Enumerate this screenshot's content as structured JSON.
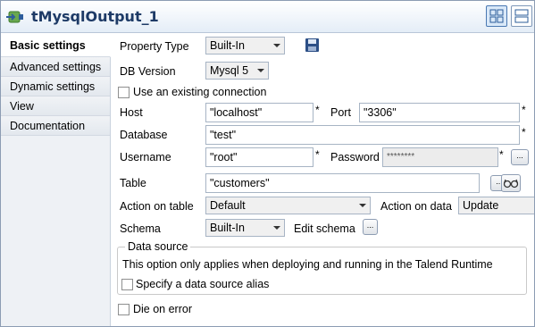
{
  "window": {
    "title": "tMysqlOutput_1"
  },
  "sidebar": {
    "items": [
      {
        "label": "Basic settings"
      },
      {
        "label": "Advanced settings"
      },
      {
        "label": "Dynamic settings"
      },
      {
        "label": "View"
      },
      {
        "label": "Documentation"
      }
    ]
  },
  "form": {
    "property_type": {
      "label": "Property Type",
      "value": "Built-In"
    },
    "db_version": {
      "label": "DB Version",
      "value": "Mysql 5"
    },
    "use_existing": {
      "label": "Use an existing connection",
      "checked": false
    },
    "host": {
      "label": "Host",
      "value": "\"localhost\""
    },
    "port": {
      "label": "Port",
      "value": "\"3306\""
    },
    "database": {
      "label": "Database",
      "value": "\"test\""
    },
    "username": {
      "label": "Username",
      "value": "\"root\""
    },
    "password": {
      "label": "Password",
      "value": "********"
    },
    "table": {
      "label": "Table",
      "value": "\"customers\""
    },
    "action_on_table": {
      "label": "Action on table",
      "value": "Default"
    },
    "action_on_data": {
      "label": "Action on data",
      "value": "Update"
    },
    "schema": {
      "label": "Schema",
      "value": "Built-In"
    },
    "edit_schema": {
      "label": "Edit schema"
    },
    "required_marker": "*",
    "ellipsis": "...",
    "data_source": {
      "title": "Data source",
      "note": "This option only applies when deploying and running in the Talend Runtime",
      "alias_label": "Specify a data source alias",
      "alias_checked": false
    },
    "die_on_error": {
      "label": "Die on error",
      "checked": false
    }
  }
}
